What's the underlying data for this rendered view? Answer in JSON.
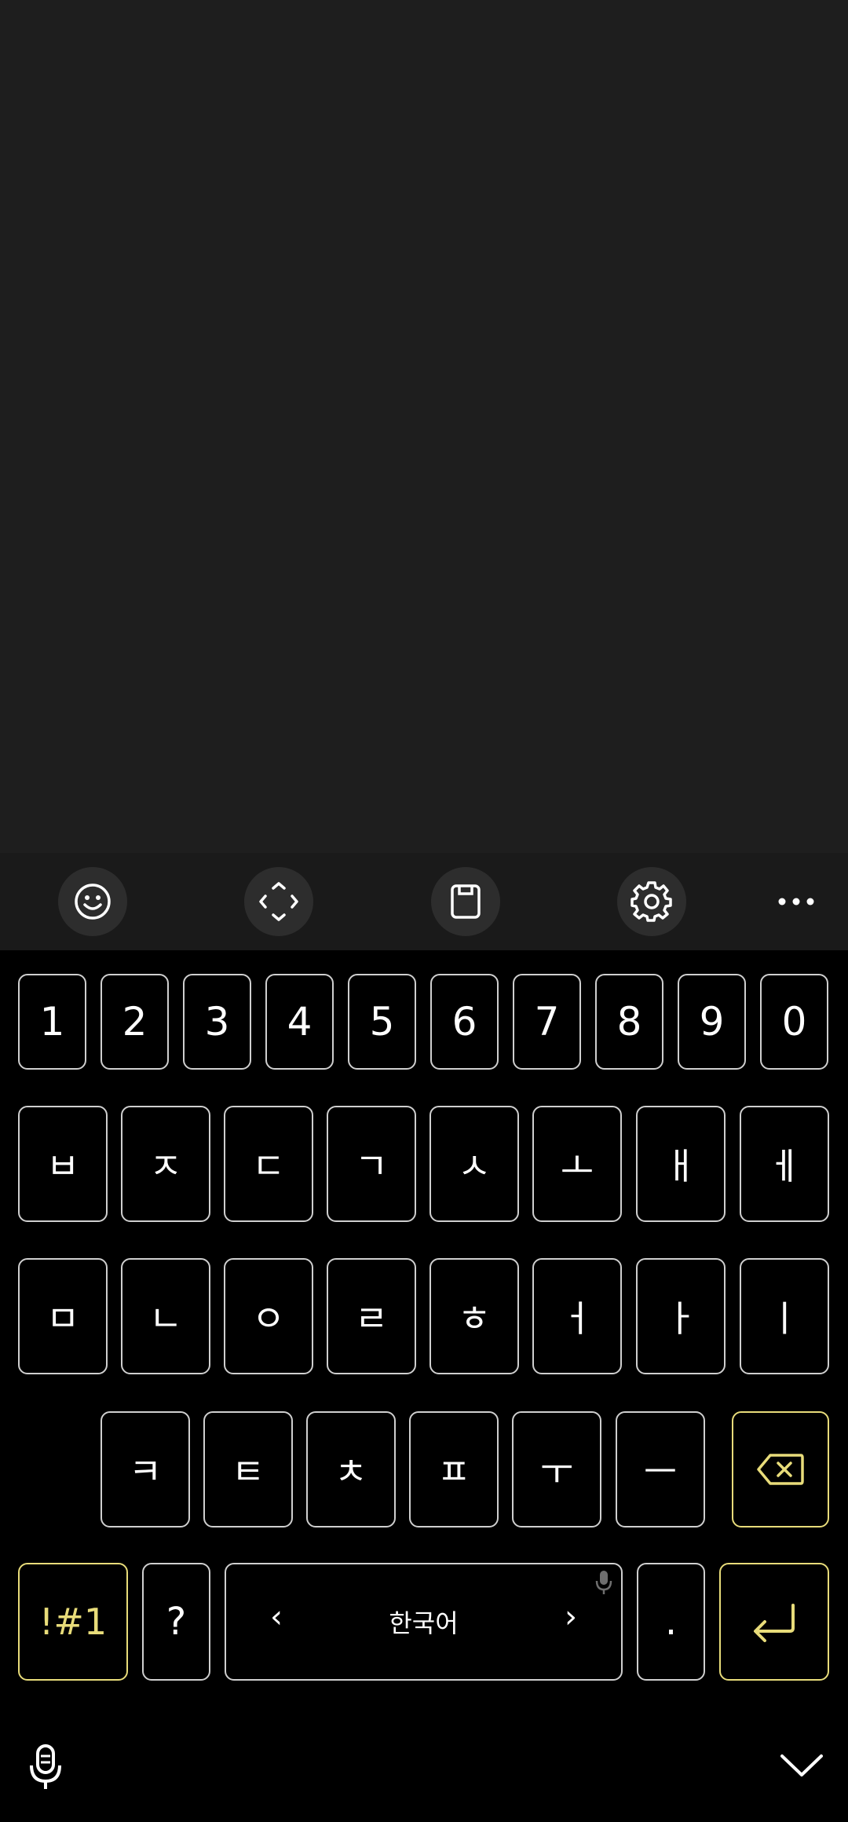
{
  "toolbar": {
    "buttons": [
      {
        "icon": "emoji-icon"
      },
      {
        "icon": "move-keyboard-icon"
      },
      {
        "icon": "clipboard-icon"
      },
      {
        "icon": "settings-gear-icon"
      },
      {
        "icon": "more-options-icon"
      }
    ]
  },
  "keyboard": {
    "numbers": [
      "1",
      "2",
      "3",
      "4",
      "5",
      "6",
      "7",
      "8",
      "9",
      "0"
    ],
    "row2": [
      "ㅂ",
      "ㅈ",
      "ㄷ",
      "ㄱ",
      "ㅅ",
      "ㅗ",
      "ㅐ",
      "ㅔ"
    ],
    "row3": [
      "ㅁ",
      "ㄴ",
      "ㅇ",
      "ㄹ",
      "ㅎ",
      "ㅓ",
      "ㅏ",
      "ㅣ"
    ],
    "row4": [
      "ㅋ",
      "ㅌ",
      "ㅊ",
      "ㅍ",
      "ㅜ",
      "ㅡ"
    ],
    "symbols_label": "!#1",
    "question_label": "?",
    "space_label": "한국어",
    "space_left_arrow": "‹",
    "space_right_arrow": "›",
    "period_label": ".",
    "accent_color": "#e8dc7a"
  },
  "bottom_bar": {
    "mic_icon": "microphone-icon",
    "hide_icon": "chevron-down-icon"
  }
}
